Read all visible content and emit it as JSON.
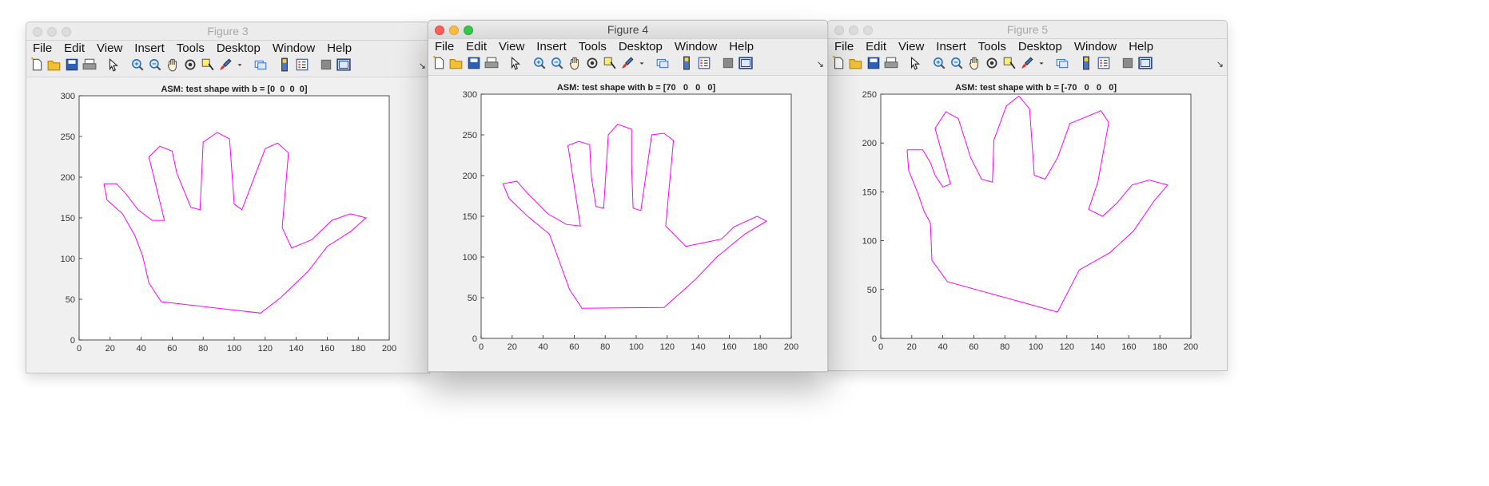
{
  "menu": [
    "File",
    "Edit",
    "View",
    "Insert",
    "Tools",
    "Desktop",
    "Window",
    "Help"
  ],
  "toolbar_icons": [
    {
      "name": "new-figure-icon"
    },
    {
      "name": "open-file-icon"
    },
    {
      "name": "save-icon"
    },
    {
      "name": "print-icon"
    },
    {
      "sep": true
    },
    {
      "name": "edit-plot-arrow-icon"
    },
    {
      "sep": true
    },
    {
      "name": "zoom-in-icon"
    },
    {
      "name": "zoom-out-icon"
    },
    {
      "name": "pan-hand-icon"
    },
    {
      "name": "rotate-3d-icon"
    },
    {
      "name": "data-cursor-icon"
    },
    {
      "name": "brush-icon"
    },
    {
      "name": "brush-dropdown-icon"
    },
    {
      "sep": true
    },
    {
      "name": "link-plot-icon"
    },
    {
      "sep": true
    },
    {
      "name": "colorbar-icon"
    },
    {
      "name": "legend-icon"
    },
    {
      "sep": true
    },
    {
      "name": "hide-plot-tools-icon"
    },
    {
      "name": "show-plot-tools-icon"
    }
  ],
  "line_color": "#ff00ff",
  "windows": [
    {
      "id": "win3",
      "title": "Figure 3",
      "active": false,
      "chart_data": {
        "type": "line",
        "title": "ASM: test shape with b = [0  0  0  0]",
        "xlabel": "",
        "ylabel": "",
        "xlim": [
          0,
          200
        ],
        "ylim": [
          0,
          300
        ],
        "xticks": [
          "0",
          "20",
          "40",
          "60",
          "80",
          "100",
          "120",
          "140",
          "160",
          "180",
          "200"
        ],
        "yticks": [
          "0",
          "50",
          "100",
          "150",
          "200",
          "250",
          "300"
        ],
        "series": [
          {
            "color": "#ff00ff",
            "points": [
              [
                16,
                192
              ],
              [
                24,
                192
              ],
              [
                30,
                180
              ],
              [
                38,
                160
              ],
              [
                47,
                147
              ],
              [
                55,
                147
              ],
              [
                45,
                225
              ],
              [
                52,
                238
              ],
              [
                60,
                232
              ],
              [
                63,
                205
              ],
              [
                72,
                163
              ],
              [
                78,
                160
              ],
              [
                80,
                243
              ],
              [
                89,
                255
              ],
              [
                97,
                247
              ],
              [
                100,
                167
              ],
              [
                105,
                160
              ],
              [
                120,
                235
              ],
              [
                128,
                242
              ],
              [
                135,
                230
              ],
              [
                131,
                138
              ],
              [
                137,
                113
              ],
              [
                150,
                123
              ],
              [
                163,
                147
              ],
              [
                175,
                155
              ],
              [
                185,
                150
              ],
              [
                175,
                133
              ],
              [
                160,
                115
              ],
              [
                148,
                85
              ],
              [
                130,
                52
              ],
              [
                117,
                33
              ],
              [
                53,
                47
              ],
              [
                45,
                70
              ],
              [
                41,
                103
              ],
              [
                36,
                128
              ],
              [
                28,
                155
              ],
              [
                18,
                172
              ],
              [
                16,
                192
              ]
            ]
          }
        ]
      }
    },
    {
      "id": "win4",
      "title": "Figure 4",
      "active": true,
      "chart_data": {
        "type": "line",
        "title": "ASM: test shape with b = [70   0   0   0]",
        "xlabel": "",
        "ylabel": "",
        "xlim": [
          0,
          200
        ],
        "ylim": [
          0,
          300
        ],
        "xticks": [
          "0",
          "20",
          "40",
          "60",
          "80",
          "100",
          "120",
          "140",
          "160",
          "180",
          "200"
        ],
        "yticks": [
          "0",
          "50",
          "100",
          "150",
          "200",
          "250",
          "300"
        ],
        "series": [
          {
            "color": "#ff00ff",
            "points": [
              [
                14,
                190
              ],
              [
                23,
                193
              ],
              [
                30,
                178
              ],
              [
                43,
                153
              ],
              [
                55,
                140
              ],
              [
                64,
                138
              ],
              [
                56,
                237
              ],
              [
                63,
                242
              ],
              [
                70,
                238
              ],
              [
                71,
                200
              ],
              [
                74,
                162
              ],
              [
                79,
                160
              ],
              [
                82,
                250
              ],
              [
                88,
                263
              ],
              [
                97,
                257
              ],
              [
                97,
                213
              ],
              [
                98,
                160
              ],
              [
                103,
                157
              ],
              [
                110,
                250
              ],
              [
                118,
                252
              ],
              [
                124,
                243
              ],
              [
                119,
                138
              ],
              [
                132,
                113
              ],
              [
                155,
                122
              ],
              [
                163,
                137
              ],
              [
                178,
                150
              ],
              [
                184,
                144
              ],
              [
                170,
                128
              ],
              [
                152,
                100
              ],
              [
                138,
                72
              ],
              [
                118,
                38
              ],
              [
                65,
                37
              ],
              [
                57,
                60
              ],
              [
                49,
                102
              ],
              [
                44,
                128
              ],
              [
                30,
                150
              ],
              [
                18,
                172
              ],
              [
                14,
                190
              ]
            ]
          }
        ]
      }
    },
    {
      "id": "win5",
      "title": "Figure 5",
      "active": false,
      "chart_data": {
        "type": "line",
        "title": "ASM: test shape with b = [-70   0   0   0]",
        "xlabel": "",
        "ylabel": "",
        "xlim": [
          0,
          200
        ],
        "ylim": [
          0,
          250
        ],
        "xticks": [
          "0",
          "20",
          "40",
          "60",
          "80",
          "100",
          "120",
          "140",
          "160",
          "180",
          "200"
        ],
        "yticks": [
          "0",
          "50",
          "100",
          "150",
          "200",
          "250"
        ],
        "series": [
          {
            "color": "#ff00ff",
            "points": [
              [
                17,
                193
              ],
              [
                27,
                193
              ],
              [
                32,
                180
              ],
              [
                35,
                167
              ],
              [
                40,
                155
              ],
              [
                45,
                158
              ],
              [
                35,
                215
              ],
              [
                42,
                232
              ],
              [
                50,
                225
              ],
              [
                58,
                185
              ],
              [
                65,
                163
              ],
              [
                72,
                160
              ],
              [
                73,
                203
              ],
              [
                81,
                238
              ],
              [
                89,
                248
              ],
              [
                96,
                235
              ],
              [
                99,
                167
              ],
              [
                106,
                163
              ],
              [
                114,
                185
              ],
              [
                122,
                220
              ],
              [
                142,
                233
              ],
              [
                147,
                221
              ],
              [
                140,
                160
              ],
              [
                134,
                132
              ],
              [
                143,
                125
              ],
              [
                152,
                138
              ],
              [
                162,
                157
              ],
              [
                173,
                162
              ],
              [
                185,
                157
              ],
              [
                176,
                140
              ],
              [
                163,
                110
              ],
              [
                148,
                88
              ],
              [
                128,
                70
              ],
              [
                114,
                27
              ],
              [
                43,
                58
              ],
              [
                33,
                80
              ],
              [
                32,
                118
              ],
              [
                28,
                130
              ],
              [
                24,
                148
              ],
              [
                18,
                172
              ],
              [
                17,
                193
              ]
            ]
          }
        ]
      }
    }
  ]
}
